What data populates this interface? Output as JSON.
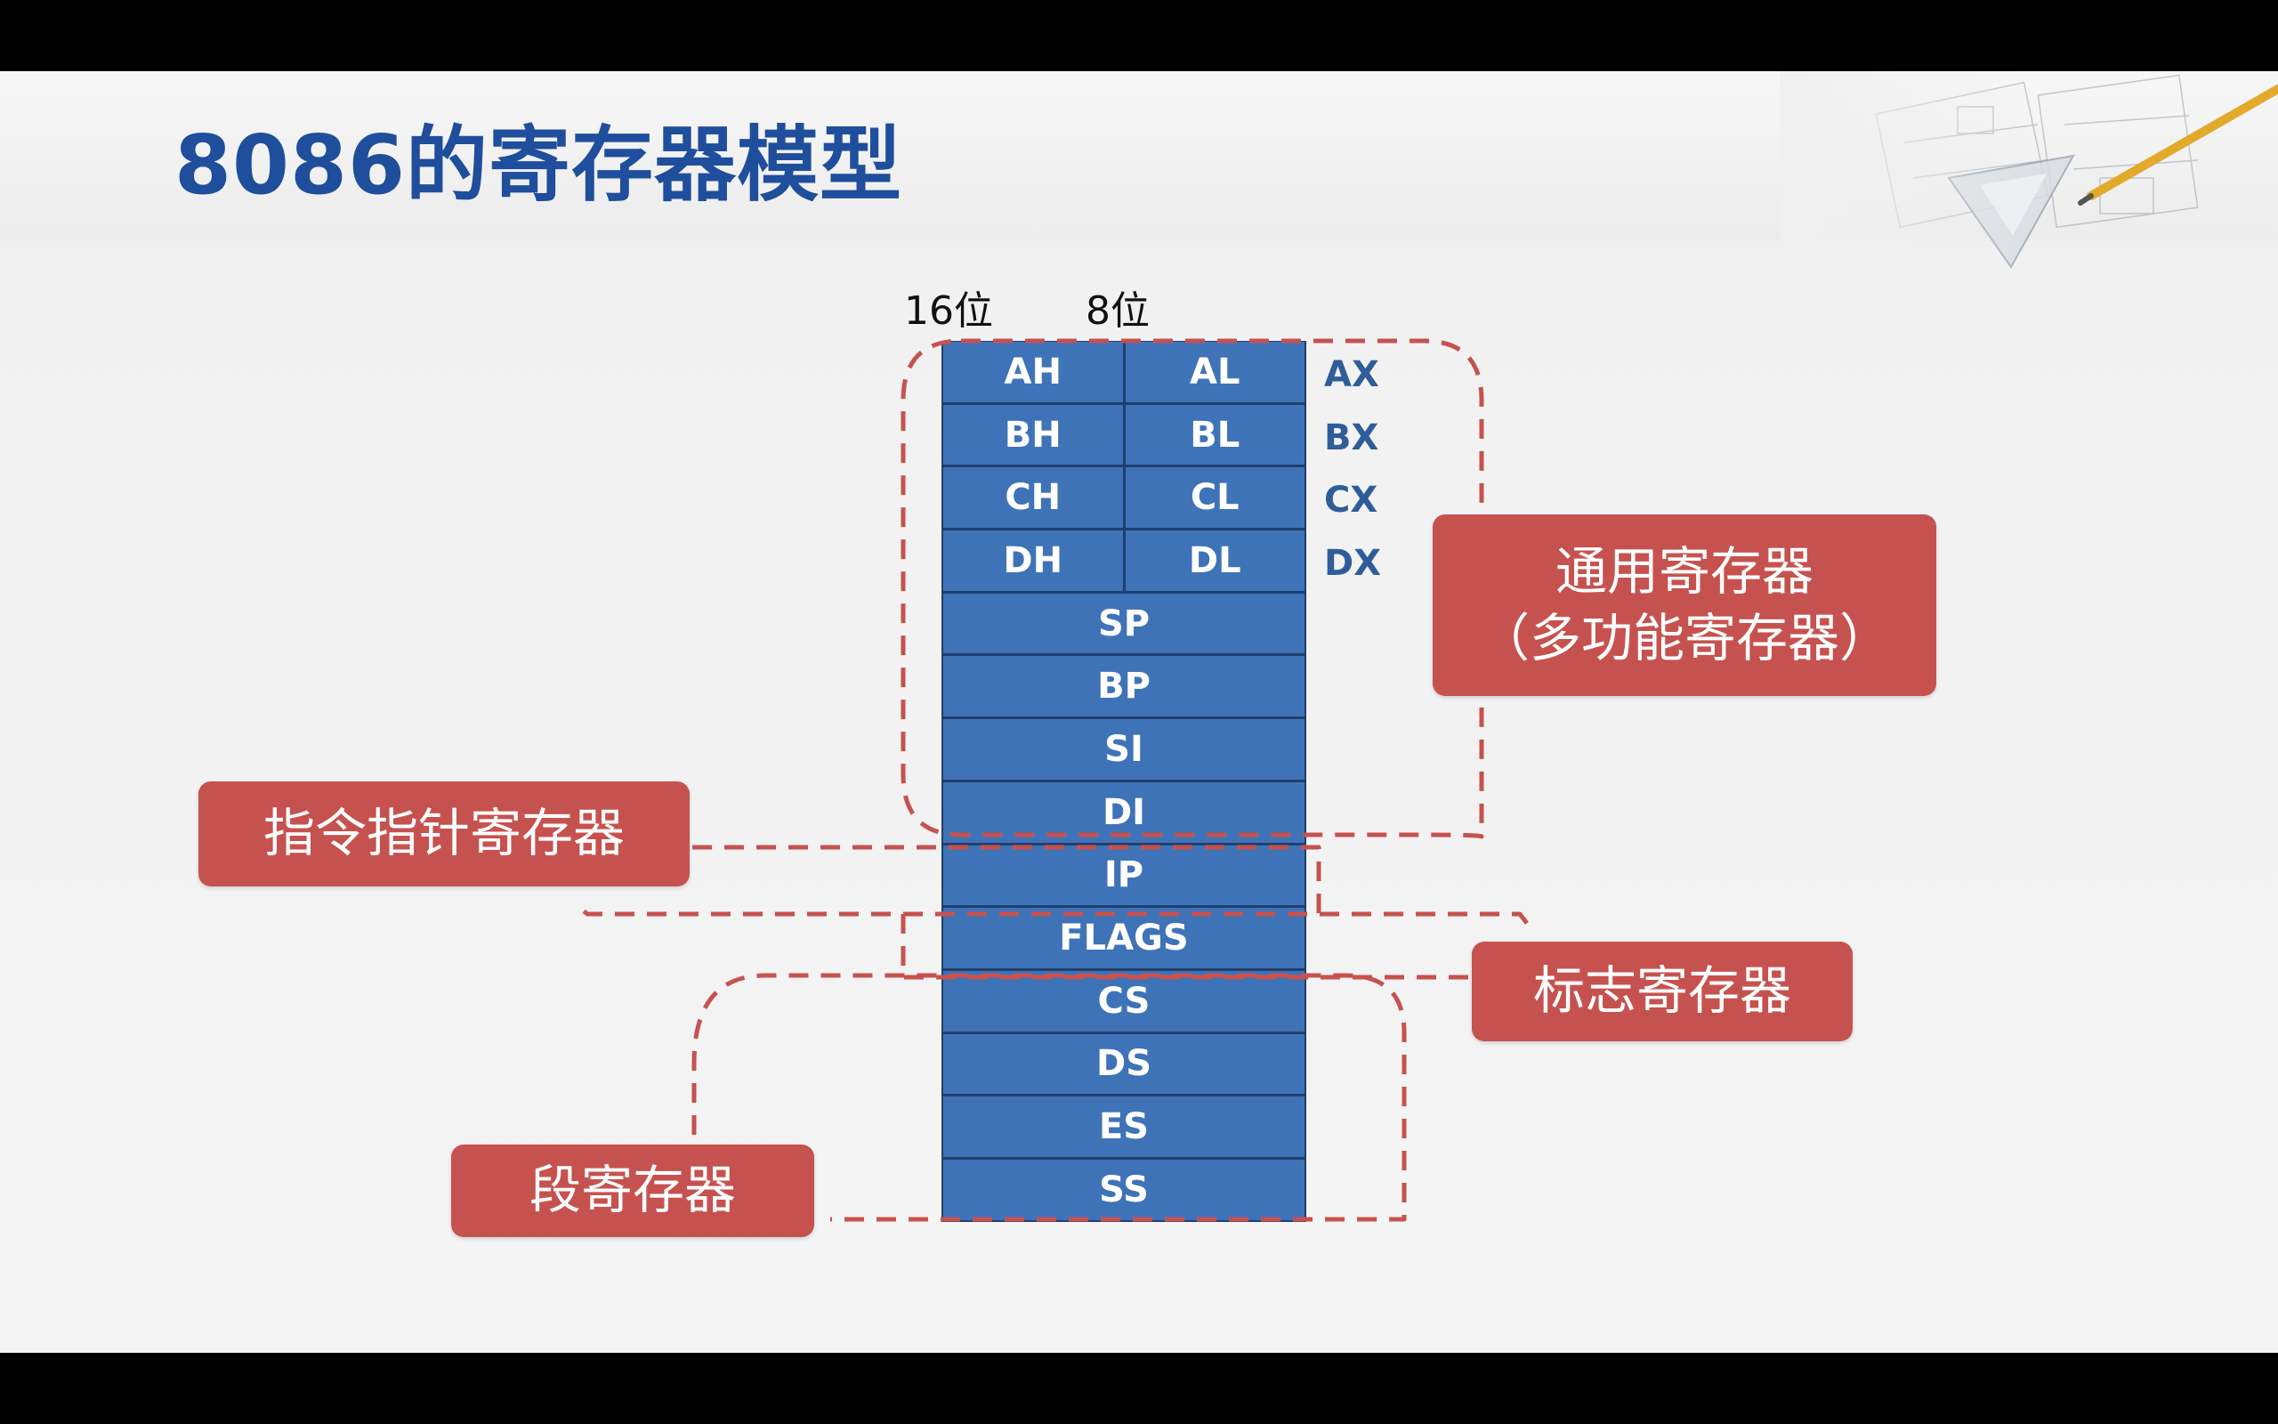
{
  "title": "8086的寄存器模型",
  "col_labels": {
    "bit16": "16位",
    "bit8": "8位"
  },
  "registers": [
    {
      "cells": [
        "AH",
        "AL"
      ],
      "pair": "AX"
    },
    {
      "cells": [
        "BH",
        "BL"
      ],
      "pair": "BX"
    },
    {
      "cells": [
        "CH",
        "CL"
      ],
      "pair": "CX"
    },
    {
      "cells": [
        "DH",
        "DL"
      ],
      "pair": "DX"
    },
    {
      "cells": [
        "SP"
      ]
    },
    {
      "cells": [
        "BP"
      ]
    },
    {
      "cells": [
        "SI"
      ]
    },
    {
      "cells": [
        "DI"
      ]
    },
    {
      "cells": [
        "IP"
      ]
    },
    {
      "cells": [
        "FLAGS"
      ]
    },
    {
      "cells": [
        "CS"
      ]
    },
    {
      "cells": [
        "DS"
      ]
    },
    {
      "cells": [
        "ES"
      ]
    },
    {
      "cells": [
        "SS"
      ]
    }
  ],
  "callouts": {
    "general_line1": "通用寄存器",
    "general_line2": "（多功能寄存器）",
    "ip": "指令指针寄存器",
    "flags": "标志寄存器",
    "segment": "段寄存器"
  },
  "colors": {
    "title": "#1f4e9c",
    "register_fill": "#3f73b8",
    "register_border": "#1f3f6e",
    "callout_fill": "#c6524f",
    "dash": "#c6524f"
  }
}
